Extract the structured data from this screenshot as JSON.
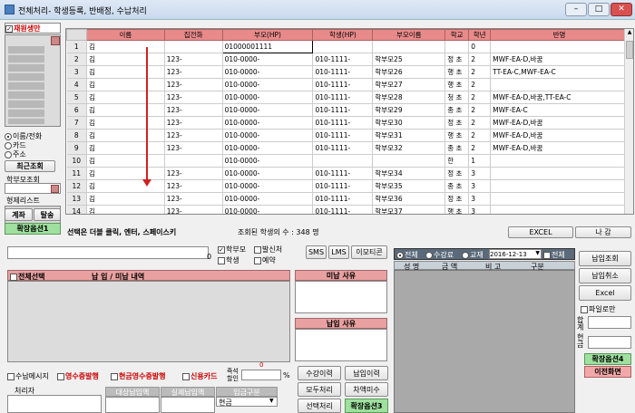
{
  "window": {
    "title": "전체처리- 학생등록, 반배정, 수납처리"
  },
  "left": {
    "checkbox_label": "재원생만",
    "radios": [
      "이름/전화",
      "카드",
      "주소"
    ],
    "recent_button": "최근조회",
    "parent_label": "학부모조회",
    "sibling_label": "형제리스트",
    "calc_button": "계좌",
    "leave_button": "탈송",
    "ext_button": "확장옵션1"
  },
  "grid": {
    "headers": [
      "이름",
      "집전화",
      "부모(HP)",
      "학생(HP)",
      "부모이름",
      "학교",
      "학년",
      "반명"
    ],
    "rows": [
      {
        "n": "1",
        "name": "김",
        "home": "",
        "phone": "01000001111",
        "student": "",
        "parent": "",
        "school": "",
        "grade": "0",
        "class": ""
      },
      {
        "n": "2",
        "name": "김",
        "home": "123-",
        "phone": "010-0000-",
        "student": "010-1111-",
        "parent": "학부모25",
        "school": "정 초",
        "grade": "2",
        "class": "MWF-EA-D,바꿈"
      },
      {
        "n": "3",
        "name": "김",
        "home": "123-",
        "phone": "010-0000-",
        "student": "010-1111-",
        "parent": "학부모26",
        "school": "행 초",
        "grade": "2",
        "class": "TT-EA-C,MWF-EA-C"
      },
      {
        "n": "4",
        "name": "김",
        "home": "123-",
        "phone": "010-0000-",
        "student": "010-1111-",
        "parent": "학부모27",
        "school": "행 초",
        "grade": "2",
        "class": ""
      },
      {
        "n": "5",
        "name": "김",
        "home": "123-",
        "phone": "010-0000-",
        "student": "010-1111-",
        "parent": "학부모28",
        "school": "청 초",
        "grade": "2",
        "class": "MWF-EA-D,바꿈,TT-EA-C"
      },
      {
        "n": "6",
        "name": "김",
        "home": "123-",
        "phone": "010-0000-",
        "student": "010-1111-",
        "parent": "학부모29",
        "school": "종 초",
        "grade": "2",
        "class": "MWF-EA-C"
      },
      {
        "n": "7",
        "name": "김",
        "home": "123-",
        "phone": "010-0000-",
        "student": "010-1111-",
        "parent": "학부모30",
        "school": "정 초",
        "grade": "2",
        "class": "MWF-EA-D,바꿈"
      },
      {
        "n": "8",
        "name": "김",
        "home": "123-",
        "phone": "010-0000-",
        "student": "010-1111-",
        "parent": "학부모31",
        "school": "행 초",
        "grade": "2",
        "class": "MWF-EA-D,바꿈"
      },
      {
        "n": "9",
        "name": "김",
        "home": "123-",
        "phone": "010-0000-",
        "student": "010-1111-",
        "parent": "학부모32",
        "school": "종 초",
        "grade": "2",
        "class": "MWF-EA-D,바꿈"
      },
      {
        "n": "10",
        "name": "김",
        "home": "",
        "phone": "010-0000-",
        "student": "",
        "parent": "",
        "school": "한",
        "grade": "1",
        "class": ""
      },
      {
        "n": "11",
        "name": "김",
        "home": "123-",
        "phone": "010-0000-",
        "student": "010-1111-",
        "parent": "학부모34",
        "school": "정 초",
        "grade": "3",
        "class": ""
      },
      {
        "n": "12",
        "name": "김",
        "home": "123-",
        "phone": "010-0000-",
        "student": "010-1111-",
        "parent": "학부모35",
        "school": "종 초",
        "grade": "3",
        "class": ""
      },
      {
        "n": "13",
        "name": "김",
        "home": "123-",
        "phone": "010-0000-",
        "student": "010-1111-",
        "parent": "학부모36",
        "school": "정 초",
        "grade": "3",
        "class": ""
      },
      {
        "n": "14",
        "name": "김",
        "home": "123-",
        "phone": "010-0000-",
        "student": "010-1111-",
        "parent": "학부모37",
        "school": "행 초",
        "grade": "3",
        "class": ""
      },
      {
        "n": "15",
        "name": "김",
        "home": "123-",
        "phone": "010-0000-",
        "student": "010-1111-",
        "parent": "학부모38",
        "school": "성 초",
        "grade": "3",
        "class": "MWF-EA-B"
      }
    ],
    "hint": "선택은 더블 클릭, 엔터, 스페이스키",
    "count_label": "조회된 학생의 수 : 348 명",
    "excel_button": "EXCEL",
    "exit_button": "나 감"
  },
  "mid": {
    "input_suffix": "0",
    "chk_parent": "학부모",
    "chk_student": "학생",
    "chk_sending": "발신처",
    "chk_reserve": "예약",
    "sms": "SMS",
    "lms": "LMS",
    "emoticon": "이모티콘"
  },
  "pay": {
    "select_all": "전체선택",
    "pay_history": "납 입 / 미납 내역",
    "unpaid_reason": "미납 사유",
    "paid_reason": "납입 사유",
    "msg": "수납메시지",
    "receipt": "영수증발행",
    "cash_receipt": "현금영수증발행",
    "card": "신용카드",
    "discount": "즉석할인",
    "discount_val": "0",
    "processor": "처리자",
    "col_target": "대상납입액",
    "col_actual": "실제납입액",
    "col_method": "입금구분",
    "method_value": "현금",
    "btn_tuition": "수강이력",
    "btn_paid": "납입이력",
    "btn_all": "모두처리",
    "btn_unpaid": "차액미수",
    "btn_select": "선택처리",
    "btn_ext3": "확장옵션3"
  },
  "right": {
    "radio_all": "전체",
    "radio_tuition": "수강료",
    "radio_book": "교재",
    "date": "2016-12-13",
    "chk_all": "전체",
    "cols": [
      "성 명",
      "금 액",
      "비 고",
      "구분"
    ],
    "btn_inquiry": "납입조회",
    "btn_cancel": "납입취소",
    "btn_excel": "Excel",
    "chk_file": "파일로만",
    "sum_label1": "합계",
    "sum_label2": "현금",
    "btn_ext4": "확장옵션4",
    "btn_prev": "이전화면"
  }
}
